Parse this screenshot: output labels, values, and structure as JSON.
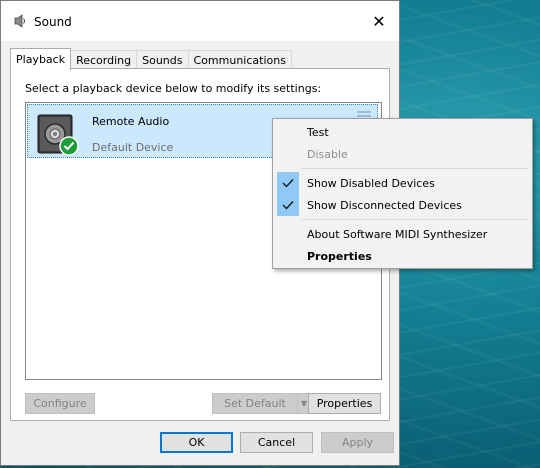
{
  "window": {
    "title": "Sound",
    "close_label": "✕"
  },
  "tabs": [
    {
      "label": "Playback"
    },
    {
      "label": "Recording"
    },
    {
      "label": "Sounds"
    },
    {
      "label": "Communications"
    }
  ],
  "panel": {
    "instruction": "Select a playback device below to modify its settings:"
  },
  "device": {
    "name": "Remote Audio",
    "status": "Default Device"
  },
  "panel_buttons": {
    "configure": "Configure",
    "set_default": "Set Default",
    "properties": "Properties"
  },
  "dialog_buttons": {
    "ok": "OK",
    "cancel": "Cancel",
    "apply": "Apply"
  },
  "context_menu": {
    "test": "Test",
    "disable": "Disable",
    "show_disabled": "Show Disabled Devices",
    "show_disconnected": "Show Disconnected Devices",
    "about_midi": "About Software MIDI Synthesizer",
    "properties": "Properties"
  },
  "colors": {
    "selection": "#cce8ff",
    "check_highlight": "#90c8f6",
    "default_green": "#1e9e3a",
    "accent": "#0078d7"
  }
}
